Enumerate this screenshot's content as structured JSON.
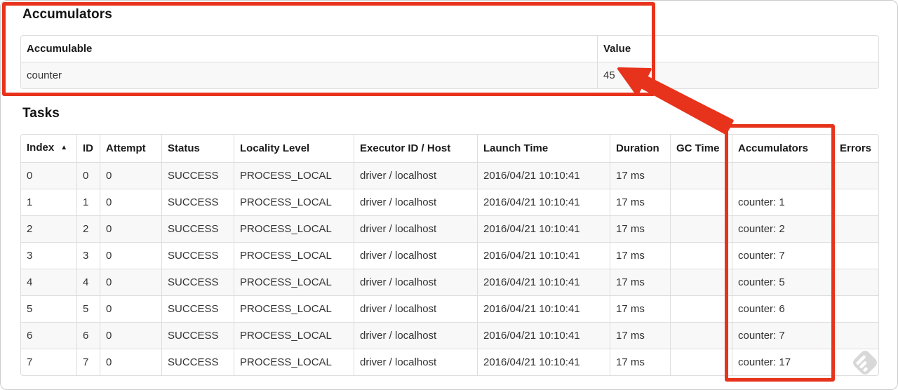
{
  "annotation_color": "#e8331c",
  "accumulators": {
    "title": "Accumulators",
    "headers": [
      "Accumulable",
      "Value"
    ],
    "rows": [
      [
        "counter",
        "45"
      ]
    ]
  },
  "tasks": {
    "title": "Tasks",
    "sort_indicator": "▲",
    "headers": [
      "Index",
      "ID",
      "Attempt",
      "Status",
      "Locality Level",
      "Executor ID / Host",
      "Launch Time",
      "Duration",
      "GC Time",
      "Accumulators",
      "Errors"
    ],
    "rows": [
      [
        "0",
        "0",
        "0",
        "SUCCESS",
        "PROCESS_LOCAL",
        "driver / localhost",
        "2016/04/21 10:10:41",
        "17 ms",
        "",
        "",
        ""
      ],
      [
        "1",
        "1",
        "0",
        "SUCCESS",
        "PROCESS_LOCAL",
        "driver / localhost",
        "2016/04/21 10:10:41",
        "17 ms",
        "",
        "counter: 1",
        ""
      ],
      [
        "2",
        "2",
        "0",
        "SUCCESS",
        "PROCESS_LOCAL",
        "driver / localhost",
        "2016/04/21 10:10:41",
        "17 ms",
        "",
        "counter: 2",
        ""
      ],
      [
        "3",
        "3",
        "0",
        "SUCCESS",
        "PROCESS_LOCAL",
        "driver / localhost",
        "2016/04/21 10:10:41",
        "17 ms",
        "",
        "counter: 7",
        ""
      ],
      [
        "4",
        "4",
        "0",
        "SUCCESS",
        "PROCESS_LOCAL",
        "driver / localhost",
        "2016/04/21 10:10:41",
        "17 ms",
        "",
        "counter: 5",
        ""
      ],
      [
        "5",
        "5",
        "0",
        "SUCCESS",
        "PROCESS_LOCAL",
        "driver / localhost",
        "2016/04/21 10:10:41",
        "17 ms",
        "",
        "counter: 6",
        ""
      ],
      [
        "6",
        "6",
        "0",
        "SUCCESS",
        "PROCESS_LOCAL",
        "driver / localhost",
        "2016/04/21 10:10:41",
        "17 ms",
        "",
        "counter: 7",
        ""
      ],
      [
        "7",
        "7",
        "0",
        "SUCCESS",
        "PROCESS_LOCAL",
        "driver / localhost",
        "2016/04/21 10:10:41",
        "17 ms",
        "",
        "counter: 17",
        ""
      ]
    ]
  }
}
